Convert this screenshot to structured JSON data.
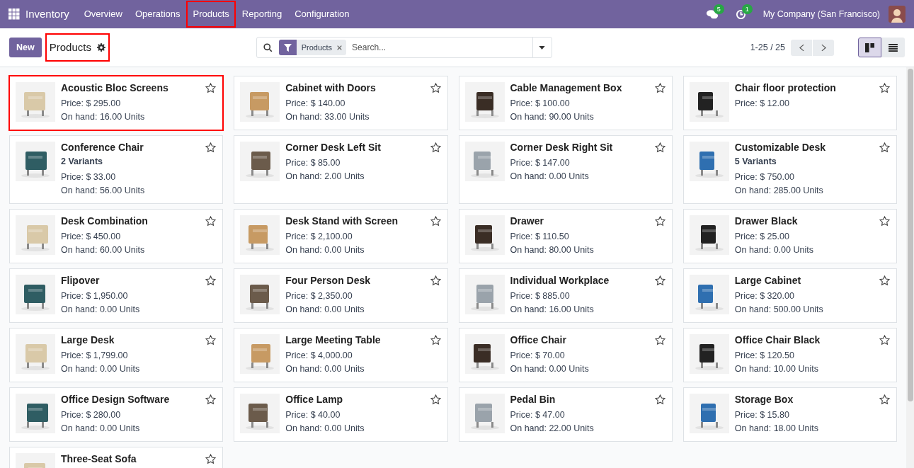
{
  "navbar": {
    "app": "Inventory",
    "menu": [
      {
        "label": "Overview",
        "highlighted": false
      },
      {
        "label": "Operations",
        "highlighted": false
      },
      {
        "label": "Products",
        "highlighted": true
      },
      {
        "label": "Reporting",
        "highlighted": false
      },
      {
        "label": "Configuration",
        "highlighted": false
      }
    ],
    "messages_badge": "5",
    "activities_badge": "1",
    "company": "My Company (San Francisco)"
  },
  "control_panel": {
    "new_button": "New",
    "title": "Products",
    "title_highlighted": true,
    "facet": "Products",
    "search_placeholder": "Search...",
    "pager": "1-25 / 25",
    "views": [
      {
        "kind": "kanban",
        "selected": true
      },
      {
        "kind": "list",
        "selected": false
      }
    ]
  },
  "products": [
    {
      "name": "Acoustic Bloc Screens",
      "price": "Price: $ 295.00",
      "on_hand": "On hand: 16.00 Units",
      "highlighted": true
    },
    {
      "name": "Cabinet with Doors",
      "price": "Price: $ 140.00",
      "on_hand": "On hand: 33.00 Units",
      "highlighted": false
    },
    {
      "name": "Cable Management Box",
      "price": "Price: $ 100.00",
      "on_hand": "On hand: 90.00 Units",
      "highlighted": false
    },
    {
      "name": "Chair floor protection",
      "price": "Price: $ 12.00",
      "highlighted": false
    },
    {
      "name": "Conference Chair",
      "variants": "2 Variants",
      "price": "Price: $ 33.00",
      "on_hand": "On hand: 56.00 Units",
      "highlighted": false
    },
    {
      "name": "Corner Desk Left Sit",
      "price": "Price: $ 85.00",
      "on_hand": "On hand: 2.00 Units",
      "highlighted": false
    },
    {
      "name": "Corner Desk Right Sit",
      "price": "Price: $ 147.00",
      "on_hand": "On hand: 0.00 Units",
      "highlighted": false
    },
    {
      "name": "Customizable Desk",
      "variants": "5 Variants",
      "price": "Price: $ 750.00",
      "on_hand": "On hand: 285.00 Units",
      "highlighted": false
    },
    {
      "name": "Desk Combination",
      "price": "Price: $ 450.00",
      "on_hand": "On hand: 60.00 Units",
      "highlighted": false
    },
    {
      "name": "Desk Stand with Screen",
      "price": "Price: $ 2,100.00",
      "on_hand": "On hand: 0.00 Units",
      "highlighted": false
    },
    {
      "name": "Drawer",
      "price": "Price: $ 110.50",
      "on_hand": "On hand: 80.00 Units",
      "highlighted": false
    },
    {
      "name": "Drawer Black",
      "price": "Price: $ 25.00",
      "on_hand": "On hand: 0.00 Units",
      "highlighted": false
    },
    {
      "name": "Flipover",
      "price": "Price: $ 1,950.00",
      "on_hand": "On hand: 0.00 Units",
      "highlighted": false
    },
    {
      "name": "Four Person Desk",
      "price": "Price: $ 2,350.00",
      "on_hand": "On hand: 0.00 Units",
      "highlighted": false
    },
    {
      "name": "Individual Workplace",
      "price": "Price: $ 885.00",
      "on_hand": "On hand: 16.00 Units",
      "highlighted": false
    },
    {
      "name": "Large Cabinet",
      "price": "Price: $ 320.00",
      "on_hand": "On hand: 500.00 Units",
      "highlighted": false
    },
    {
      "name": "Large Desk",
      "price": "Price: $ 1,799.00",
      "on_hand": "On hand: 0.00 Units",
      "highlighted": false
    },
    {
      "name": "Large Meeting Table",
      "price": "Price: $ 4,000.00",
      "on_hand": "On hand: 0.00 Units",
      "highlighted": false
    },
    {
      "name": "Office Chair",
      "price": "Price: $ 70.00",
      "on_hand": "On hand: 0.00 Units",
      "highlighted": false
    },
    {
      "name": "Office Chair Black",
      "price": "Price: $ 120.50",
      "on_hand": "On hand: 10.00 Units",
      "highlighted": false
    },
    {
      "name": "Office Design Software",
      "price": "Price: $ 280.00",
      "on_hand": "On hand: 0.00 Units",
      "highlighted": false
    },
    {
      "name": "Office Lamp",
      "price": "Price: $ 40.00",
      "on_hand": "On hand: 0.00 Units",
      "highlighted": false
    },
    {
      "name": "Pedal Bin",
      "price": "Price: $ 47.00",
      "on_hand": "On hand: 22.00 Units",
      "highlighted": false
    },
    {
      "name": "Storage Box",
      "price": "Price: $ 15.80",
      "on_hand": "On hand: 18.00 Units",
      "highlighted": false
    },
    {
      "name": "Three-Seat Sofa",
      "highlighted": false
    }
  ]
}
